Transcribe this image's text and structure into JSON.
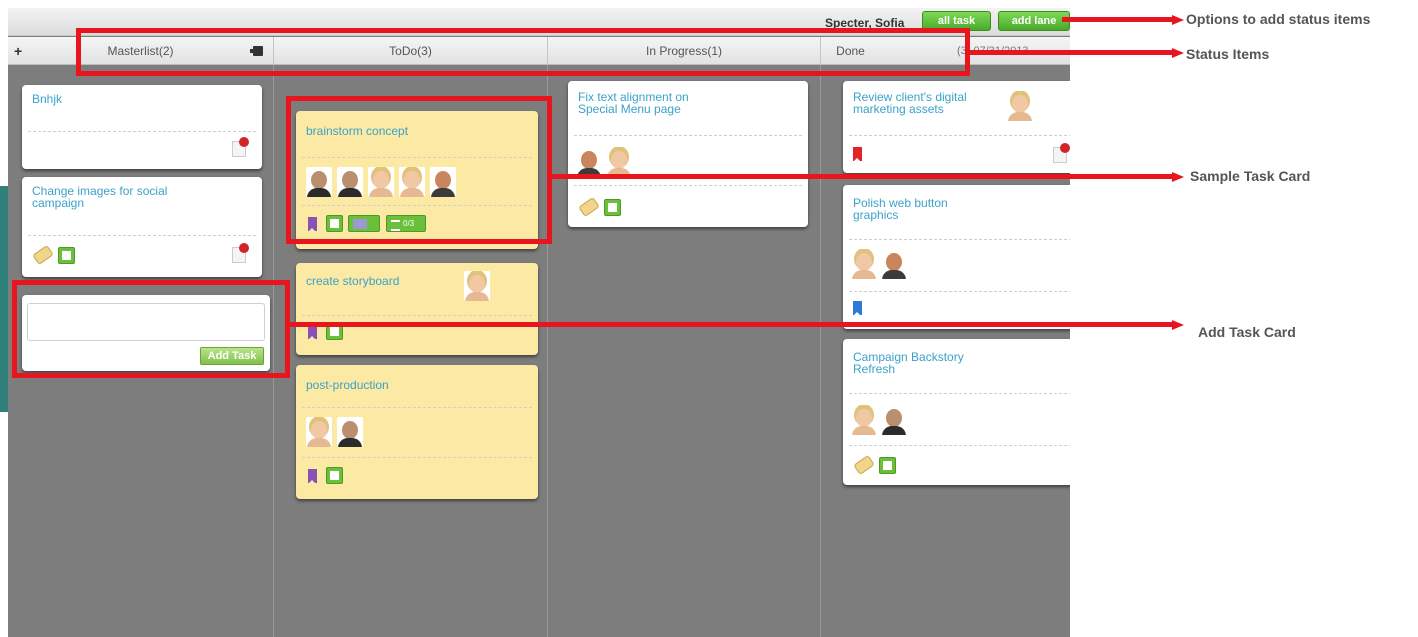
{
  "topbar": {
    "user_name": "Specter, Sofia",
    "all_task_label": "all task",
    "add_lane_label": "add lane"
  },
  "lanes": {
    "masterlist": "Masterlist(2)",
    "todo": "ToDo(3)",
    "in_progress": "In Progress(1)",
    "done": "Done",
    "done_extra": "(3)  07/31/2013",
    "add_lane_icon": "+"
  },
  "masterlist_cards": [
    {
      "title": "Bnhjk"
    },
    {
      "title": "Change images for social campaign"
    }
  ],
  "add_task": {
    "placeholder": "",
    "button_label": "Add Task"
  },
  "todo_cards": [
    {
      "title": "brainstorm concept",
      "checklist": "0/3"
    },
    {
      "title": "create storyboard"
    },
    {
      "title": "post-production"
    }
  ],
  "in_progress_cards": [
    {
      "title": "Fix text alignment on Special Menu page"
    }
  ],
  "done_cards": [
    {
      "title": "Review client's digital marketing assets"
    },
    {
      "title": "Polish web button graphics"
    },
    {
      "title": "Campaign Backstory Refresh"
    }
  ],
  "annotations": {
    "options": "Options to add status items",
    "status_items": "Status Items",
    "sample_task_card": "Sample Task Card",
    "add_task_card": "Add Task Card"
  },
  "colors": {
    "highlight": "#e8151e",
    "lane_bg": "#7d7d7d",
    "card_yellow": "#fbe9a4",
    "title_blue": "#3aa2c9",
    "button_green": "#4aa82a"
  }
}
